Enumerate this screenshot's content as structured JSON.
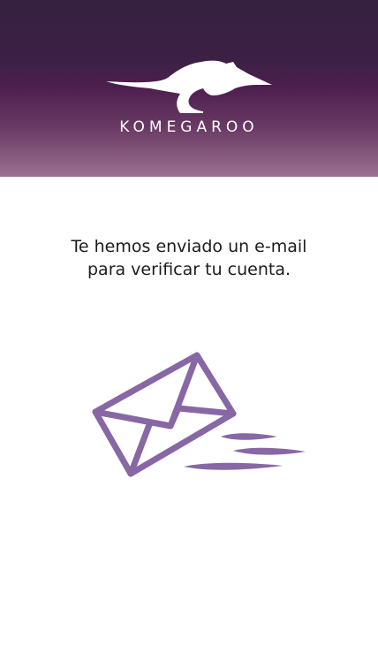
{
  "header": {
    "brand_name": "KOMEGAROO",
    "gradient_colors": [
      "#34223f",
      "#4e1f4f",
      "#9a7090"
    ]
  },
  "main": {
    "message_line1": "Te hemos enviado un e-mail",
    "message_line2": "para verificar tu cuenta.",
    "illustration_icon": "sent-envelope-icon",
    "accent_color": "#8767a4"
  }
}
